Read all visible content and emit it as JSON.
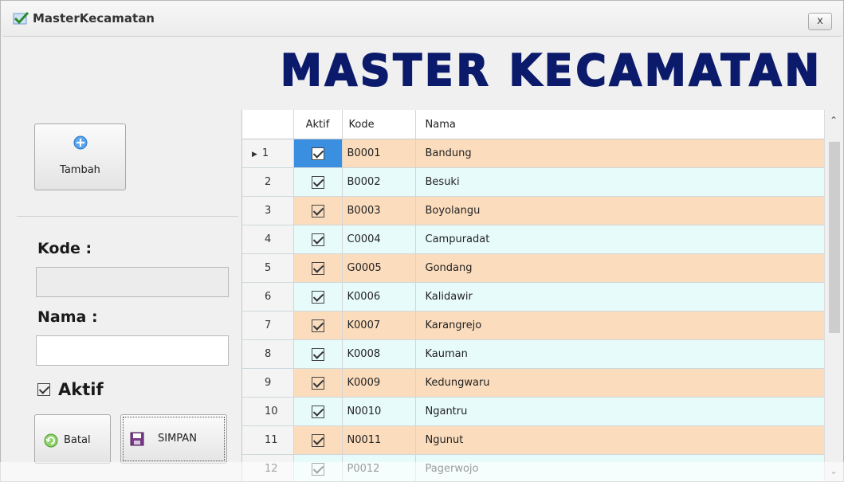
{
  "window": {
    "title": "MasterKecamatan",
    "close_label": "x"
  },
  "banner": {
    "text": "MASTER KECAMATAN"
  },
  "toolbar": {
    "add_label": "Tambah"
  },
  "form": {
    "kode_label": "Kode :",
    "kode_value": "",
    "nama_label": "Nama :",
    "nama_value": "",
    "aktif_label": "Aktif",
    "aktif_checked": true,
    "cancel_label": "Batal",
    "save_label": "SIMPAN"
  },
  "grid": {
    "columns": [
      "Aktif",
      "Kode",
      "Nama"
    ],
    "rows": [
      {
        "no": "1",
        "aktif": true,
        "kode": "B0001",
        "nama": "Bandung"
      },
      {
        "no": "2",
        "aktif": true,
        "kode": "B0002",
        "nama": "Besuki"
      },
      {
        "no": "3",
        "aktif": true,
        "kode": "B0003",
        "nama": "Boyolangu"
      },
      {
        "no": "4",
        "aktif": true,
        "kode": "C0004",
        "nama": "Campuradat"
      },
      {
        "no": "5",
        "aktif": true,
        "kode": "G0005",
        "nama": "Gondang"
      },
      {
        "no": "6",
        "aktif": true,
        "kode": "K0006",
        "nama": "Kalidawir"
      },
      {
        "no": "7",
        "aktif": true,
        "kode": "K0007",
        "nama": "Karangrejo"
      },
      {
        "no": "8",
        "aktif": true,
        "kode": "K0008",
        "nama": "Kauman"
      },
      {
        "no": "9",
        "aktif": true,
        "kode": "K0009",
        "nama": "Kedungwaru"
      },
      {
        "no": "10",
        "aktif": true,
        "kode": "N0010",
        "nama": "Ngantru"
      },
      {
        "no": "11",
        "aktif": true,
        "kode": "N0011",
        "nama": "Ngunut"
      },
      {
        "no": "12",
        "aktif": true,
        "kode": "P0012",
        "nama": "Pagerwojo"
      }
    ],
    "selected_row": 0
  },
  "colors": {
    "row_odd": "#fbdcbd",
    "row_even": "#e8fbfb",
    "banner": "#0b1a6b",
    "accent": "#3b8fe0"
  }
}
